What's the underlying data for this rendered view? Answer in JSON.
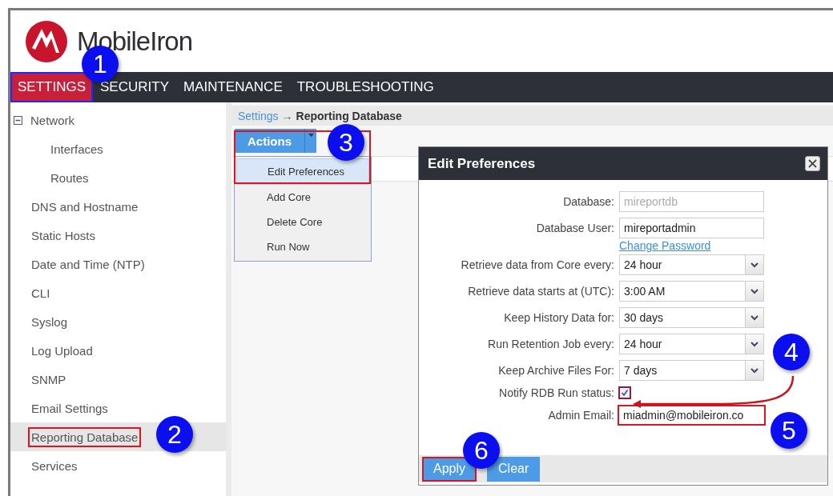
{
  "logo": {
    "text": "MobileIron"
  },
  "nav": [
    {
      "label": "SETTINGS",
      "selected": true,
      "highlighted": true
    },
    {
      "label": "SECURITY",
      "selected": false,
      "highlighted": false
    },
    {
      "label": "MAINTENANCE",
      "selected": false,
      "highlighted": false
    },
    {
      "label": "TROUBLESHOOTING",
      "selected": false,
      "highlighted": false
    }
  ],
  "sidebar": {
    "items": [
      {
        "label": "Network",
        "expanded": true,
        "selected": false,
        "highlighted": false,
        "children": [
          {
            "label": "Interfaces",
            "selected": false,
            "highlighted": false
          },
          {
            "label": "Routes",
            "selected": false,
            "highlighted": false
          }
        ]
      },
      {
        "label": "DNS and Hostname",
        "selected": false,
        "highlighted": false
      },
      {
        "label": "Static Hosts",
        "selected": false,
        "highlighted": false
      },
      {
        "label": "Date and Time (NTP)",
        "selected": false,
        "highlighted": false
      },
      {
        "label": "CLI",
        "selected": false,
        "highlighted": false
      },
      {
        "label": "Syslog",
        "selected": false,
        "highlighted": false
      },
      {
        "label": "Log Upload",
        "selected": false,
        "highlighted": false
      },
      {
        "label": "SNMP",
        "selected": false,
        "highlighted": false
      },
      {
        "label": "Email Settings",
        "selected": false,
        "highlighted": false
      },
      {
        "label": "Reporting Database",
        "selected": true,
        "highlighted": true
      },
      {
        "label": "Services",
        "selected": false,
        "highlighted": false
      }
    ]
  },
  "breadcrumb": {
    "link": "Settings",
    "separator": "→",
    "current": "Reporting Database"
  },
  "actions": {
    "label": "Actions",
    "highlighted": true,
    "menu": [
      {
        "label": "Edit Preferences",
        "selected": true
      },
      {
        "label": "Add Core",
        "selected": false
      },
      {
        "label": "Delete Core",
        "selected": false
      },
      {
        "label": "Run Now",
        "selected": false
      }
    ]
  },
  "dialog": {
    "title": "Edit Preferences",
    "fields": [
      {
        "kind": "text",
        "label": "Database:",
        "value": "mireportdb",
        "disabled": true,
        "highlighted": false
      },
      {
        "kind": "text",
        "label": "Database User:",
        "value": "mireportadmin",
        "disabled": false,
        "highlighted": false
      },
      {
        "kind": "link",
        "text": "Change Password"
      },
      {
        "kind": "select",
        "label": "Retrieve data from Core every:",
        "value": "24 hour"
      },
      {
        "kind": "select",
        "label": "Retrieve data starts at (UTC):",
        "value": "3:00 AM"
      },
      {
        "kind": "select",
        "label": "Keep History Data for:",
        "value": "30 days"
      },
      {
        "kind": "select",
        "label": "Run Retention Job every:",
        "value": "24 hour"
      },
      {
        "kind": "select",
        "label": "Keep Archive Files For:",
        "value": "7 days"
      },
      {
        "kind": "checkbox",
        "label": "Notify RDB Run status:",
        "checked": true
      },
      {
        "kind": "text",
        "label": "Admin Email:",
        "value": "miadmin@mobileiron.co",
        "disabled": false,
        "highlighted": true
      }
    ],
    "buttons": [
      {
        "label": "Apply",
        "highlighted": true
      },
      {
        "label": "Clear",
        "highlighted": false
      }
    ]
  },
  "callouts": [
    {
      "label": "1"
    },
    {
      "label": "2"
    },
    {
      "label": "3"
    },
    {
      "label": "4"
    },
    {
      "label": "5"
    },
    {
      "label": "6"
    }
  ]
}
